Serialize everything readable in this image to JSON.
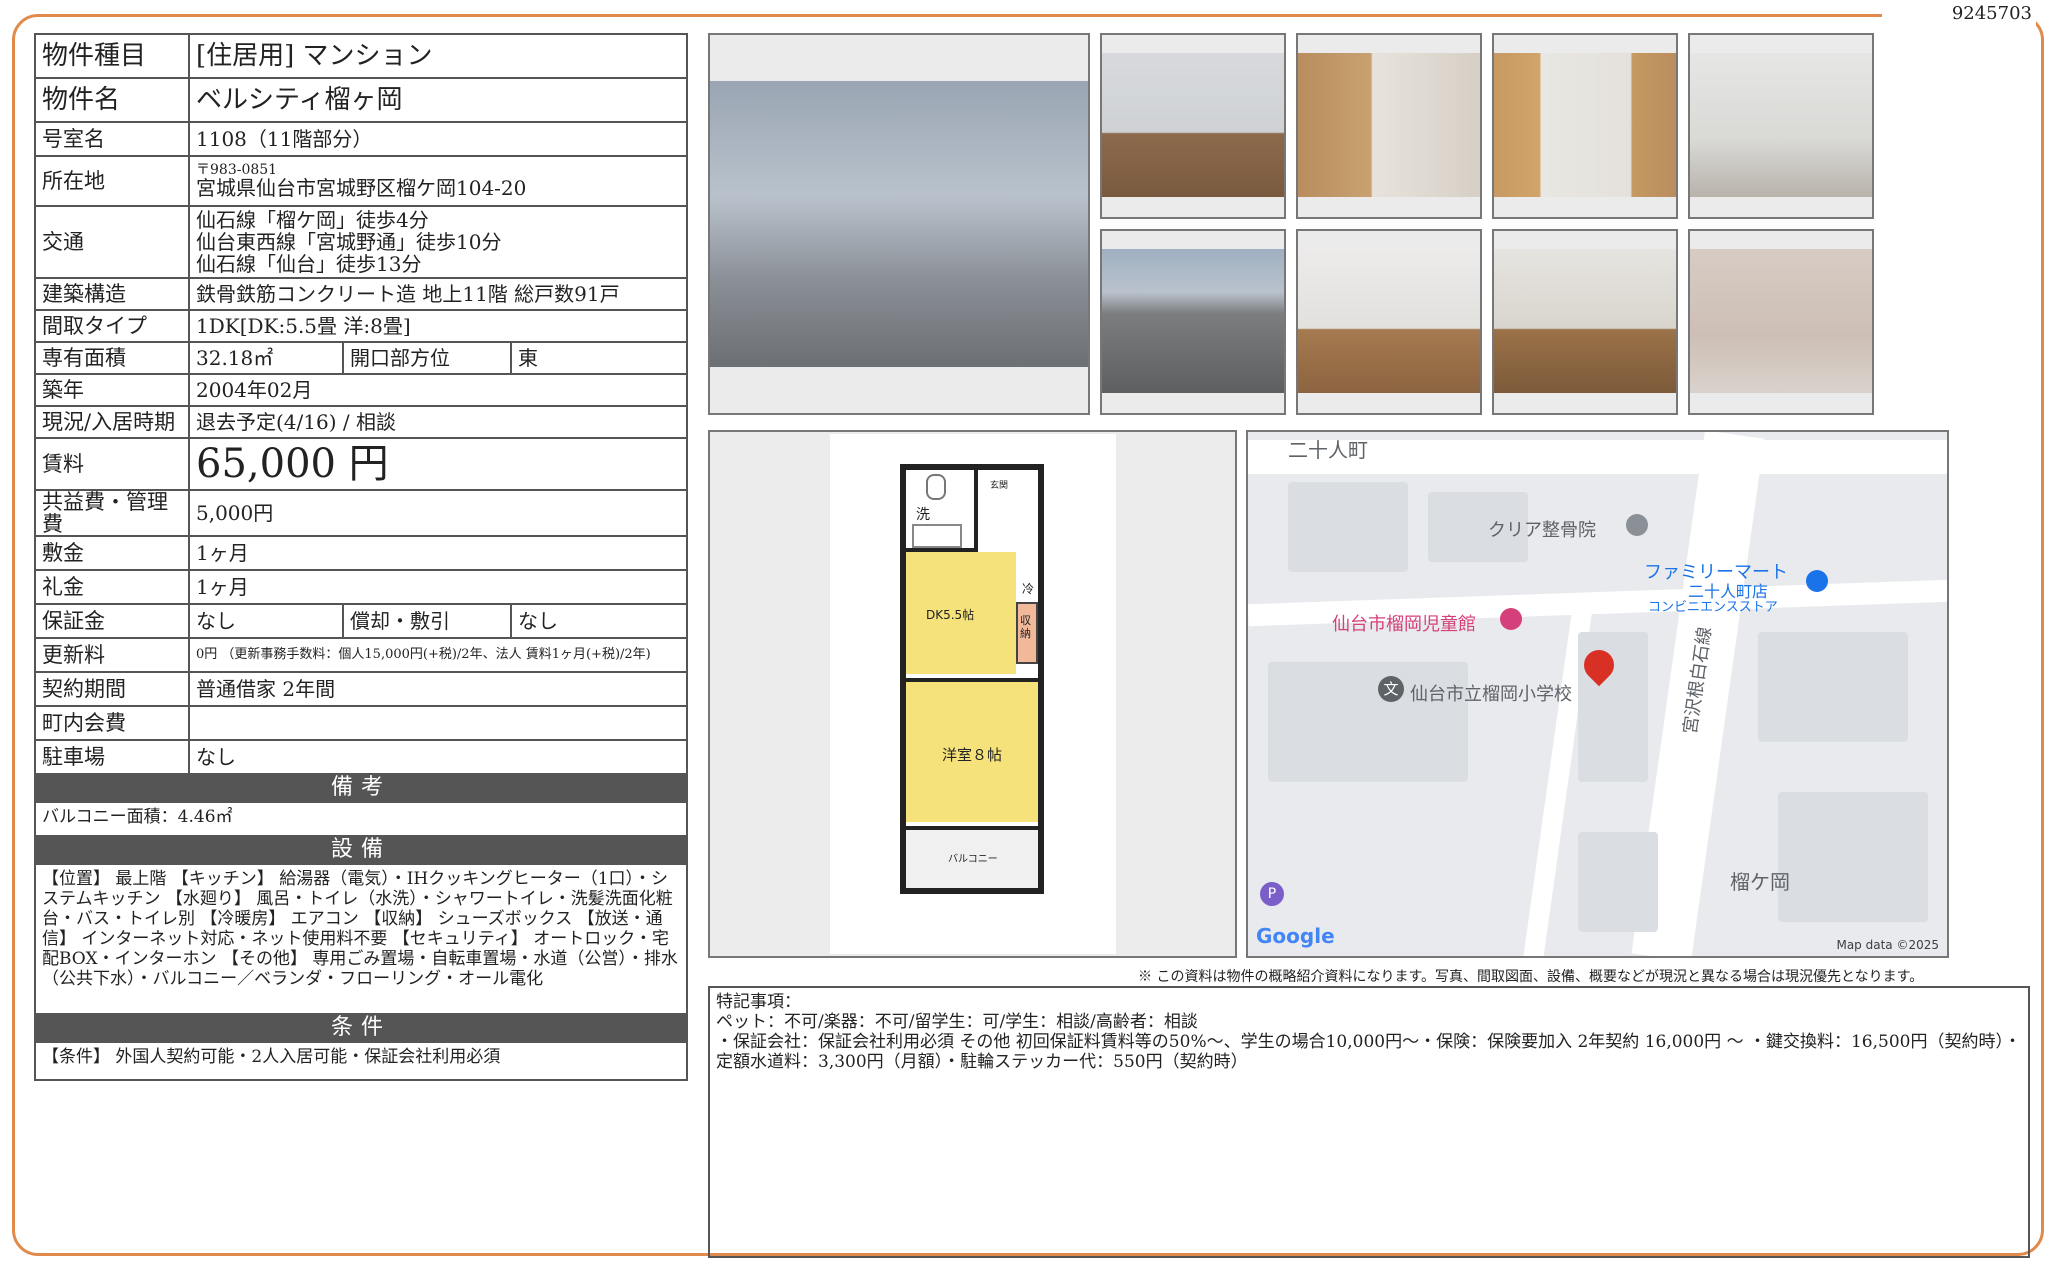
{
  "doc_number": "9245703",
  "spec": {
    "type_label": "物件種目",
    "type_value": "[住居用]  マンション",
    "name_label": "物件名",
    "name_value": "ベルシティ榴ヶ岡",
    "room_label": "号室名",
    "room_value": "1108（11階部分）",
    "address_label": "所在地",
    "zip": "〒983-0851",
    "address": "宮城県仙台市宮城野区榴ケ岡104-20",
    "access_label": "交通",
    "access": [
      "仙石線「榴ケ岡」徒歩4分",
      "仙台東西線「宮城野通」徒歩10分",
      "仙石線「仙台」徒歩13分"
    ],
    "structure_label": "建築構造",
    "structure_value": "鉄骨鉄筋コンクリート造 地上11階 総戸数91戸",
    "layout_label": "間取タイプ",
    "layout_value": "1DK[DK:5.5畳 洋:8畳]",
    "area_label": "専有面積",
    "area_value": "32.18㎡",
    "facing_label": "開口部方位",
    "facing_value": "東",
    "built_label": "築年",
    "built_value": "2004年02月",
    "status_label": "現況/入居時期",
    "status_value": "退去予定(4/16)  /  相談",
    "rent_label": "賃料",
    "rent_value": "65,000 円",
    "fee_label": "共益費・管理費",
    "fee_value": "5,000円",
    "deposit_label": "敷金",
    "deposit_value": "1ヶ月",
    "key_money_label": "礼金",
    "key_money_value": "1ヶ月",
    "guarantee_label": "保証金",
    "guarantee_value": "なし",
    "amort_label": "償却・敷引",
    "amort_value": "なし",
    "renewal_label": "更新料",
    "renewal_value": "0円 （更新事務手数料：個人15,000円(+税)/2年、法人 賃料1ヶ月(+税)/2年)",
    "contract_label": "契約期間",
    "contract_value": "普通借家  2年間",
    "assoc_label": "町内会費",
    "assoc_value": "",
    "parking_label": "駐車場",
    "parking_value": "なし"
  },
  "sections": {
    "remarks_title": "備考",
    "remarks_text": "バルコニー面積：4.46㎡",
    "equipment_title": "設備",
    "equipment_text": "【位置】 最上階 【キッチン】 給湯器（電気）・IHクッキングヒーター（1口）・システムキッチン 【水廻り】 風呂・トイレ（水洗）・シャワートイレ・洗髪洗面化粧台・バス・トイレ別 【冷暖房】 エアコン 【収納】 シューズボックス 【放送・通信】 インターネット対応・ネット使用料不要 【セキュリティ】 オートロック・宅配BOX・インターホン 【その他】 専用ごみ置場・自転車置場・水道（公営）・排水（公共下水）・バルコニー／ベランダ・フローリング・オール電化",
    "conditions_title": "条件",
    "conditions_text": "【条件】 外国人契約可能・2人入居可能・保証会社利用必須"
  },
  "floorplan": {
    "wash": "洗",
    "genkan": "玄関",
    "fridge": "冷",
    "storage": "収納",
    "dk": "DK5.5帖",
    "western": "洋室８帖",
    "balcony": "バルコニー"
  },
  "map": {
    "labels": {
      "nijuninmachi": "二十人町",
      "clinic": "クリア整骨院",
      "familymart": "ファミリーマート",
      "familymart_branch": "二十人町店",
      "convenience": "コンビニエンスストア",
      "jidokan": "仙台市榴岡児童館",
      "school": "仙台市立榴岡小学校",
      "road": "宮沢根白石線",
      "tsutsujigaoka": "榴ケ岡",
      "google": "Google",
      "mapdata": "Map data ©2025",
      "school_badge": "文",
      "parking_badge": "P"
    },
    "colors": {
      "pin": "#d93025",
      "poi_pink": "#d6407a",
      "poi_blue": "#1a73e8",
      "road": "#ffffff",
      "block": "#dadde1"
    }
  },
  "notice": "※ この資料は物件の概略紹介資料になります。写真、間取図面、設備、概要などが現況と異なる場合は現況優先となります。",
  "special": {
    "title": "特記事項：",
    "line1": "ペット：不可/楽器：不可/留学生：可/学生：相談/高齢者：相談",
    "line2": "・保証会社：保証会社利用必須 その他 初回保証料賃料等の50%～、学生の場合10,000円～・保険：保険要加入 2年契約 16,000円 ～ ・鍵交換料：16,500円（契約時）・定額水道料：3,300円（月額）・駐輪ステッカー代：550円（契約時）"
  },
  "colors": {
    "frame": "#e08a4c",
    "section_bg": "#555555",
    "plan_yellow": "#f6e27a"
  }
}
